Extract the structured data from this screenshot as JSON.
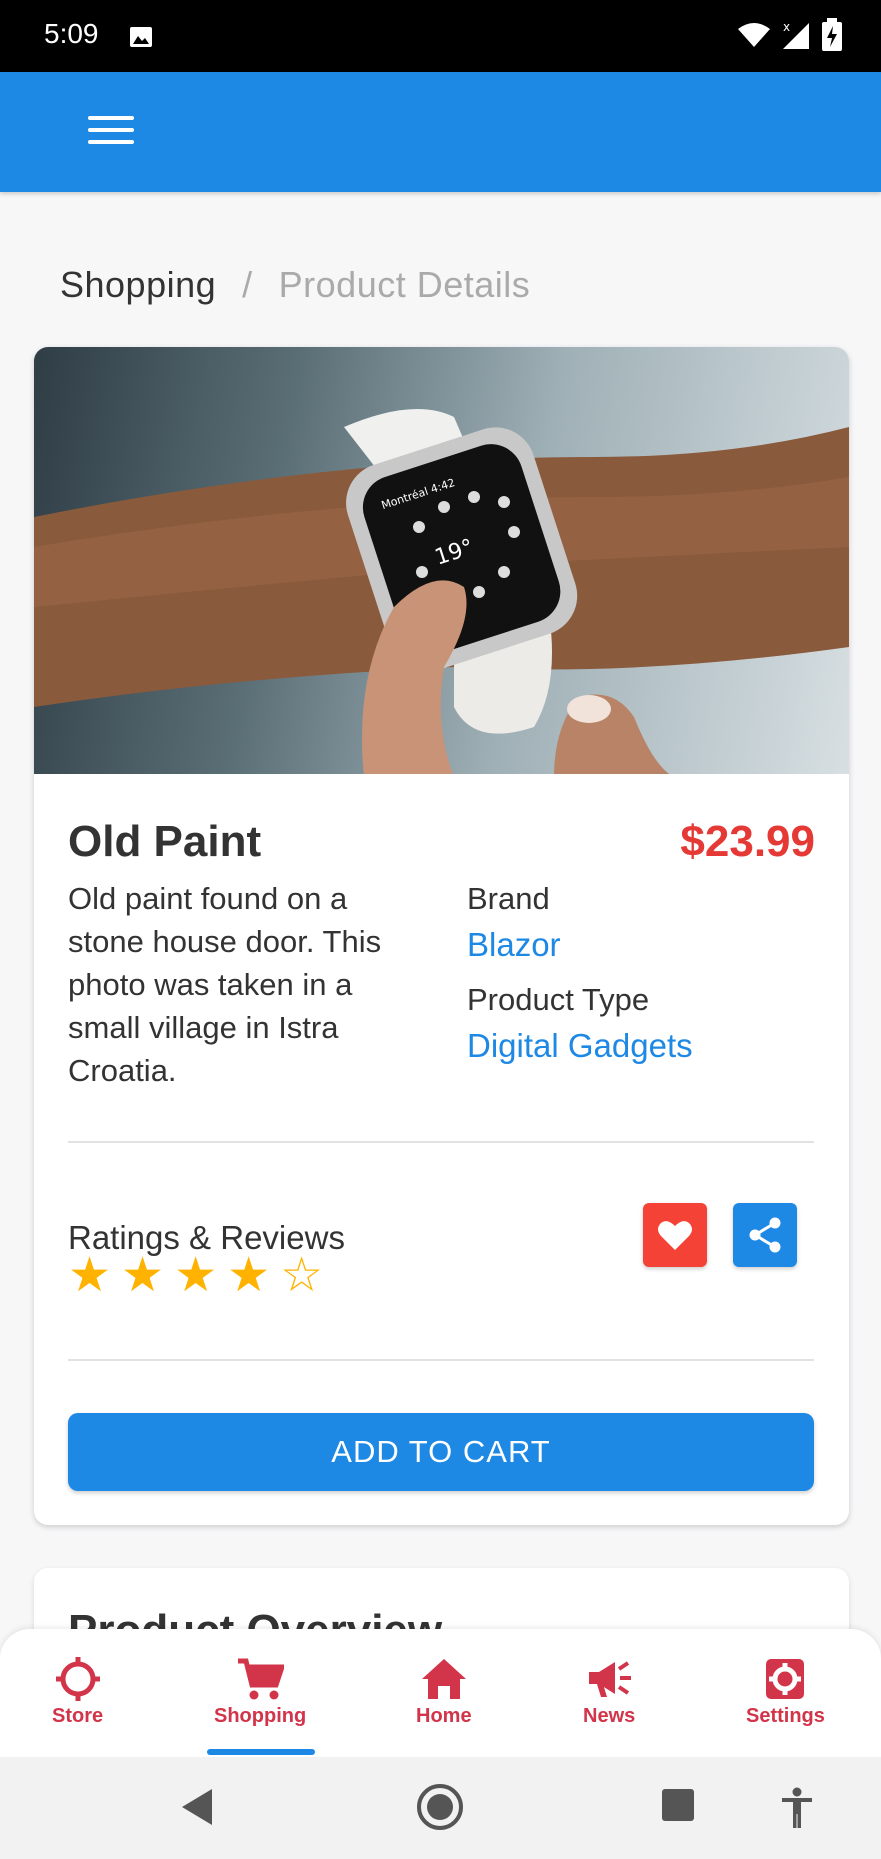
{
  "status_bar": {
    "time": "5:09"
  },
  "breadcrumb": {
    "current": "Shopping",
    "separator": "/",
    "page": "Product Details"
  },
  "product": {
    "title": "Old Paint",
    "price": "$23.99",
    "description": "Old paint found on a stone house door. This photo was taken in a small village in Istra Croatia.",
    "brand_label": "Brand",
    "brand_value": "Blazor",
    "type_label": "Product Type",
    "type_value": "Digital Gadgets"
  },
  "ratings": {
    "title": "Ratings & Reviews",
    "rating": 4,
    "max": 5
  },
  "actions": {
    "add_to_cart": "ADD TO CART"
  },
  "overview": {
    "title": "Product Overview"
  },
  "bottom_nav": [
    {
      "label": "Store",
      "icon": "crosshair-icon"
    },
    {
      "label": "Shopping",
      "icon": "cart-icon",
      "active": true
    },
    {
      "label": "Home",
      "icon": "home-icon"
    },
    {
      "label": "News",
      "icon": "megaphone-icon"
    },
    {
      "label": "Settings",
      "icon": "gear-icon"
    }
  ],
  "colors": {
    "primary": "#1e88e5",
    "price": "#e53935",
    "nav_accent": "#d2344a",
    "star": "#ffb300"
  }
}
